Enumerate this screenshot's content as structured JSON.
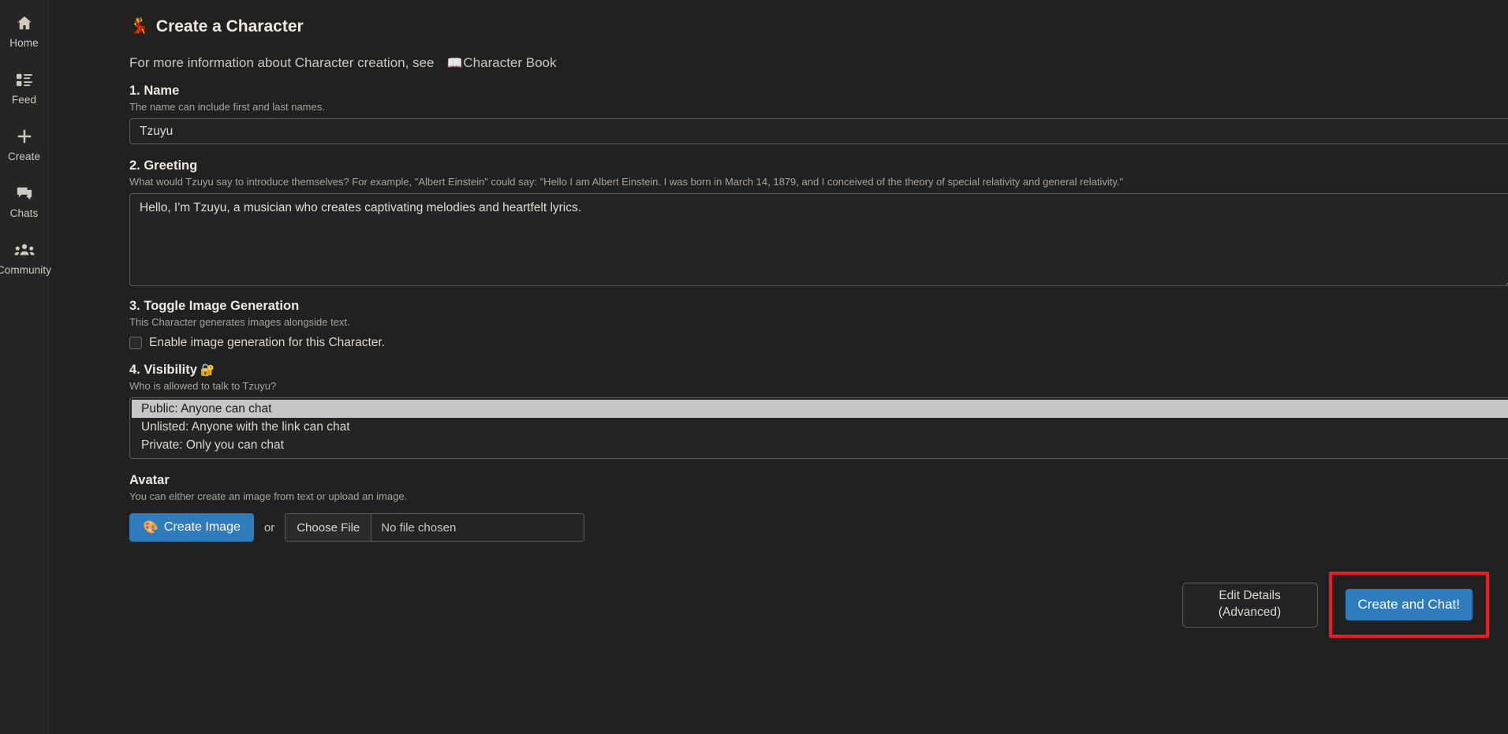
{
  "sidebar": {
    "items": [
      {
        "label": "Home",
        "icon": "home-icon"
      },
      {
        "label": "Feed",
        "icon": "feed-icon"
      },
      {
        "label": "Create",
        "icon": "plus-icon"
      },
      {
        "label": "Chats",
        "icon": "chat-bubbles-icon"
      },
      {
        "label": "Community",
        "icon": "people-icon"
      }
    ]
  },
  "header": {
    "title": "Create a Character",
    "title_icon": "💃",
    "info_prefix": "For more information about Character creation, see",
    "book_icon": "📖",
    "info_link": "Character Book"
  },
  "sections": {
    "name": {
      "title": "1. Name",
      "help": "The name can include first and last names.",
      "value": "Tzuyu",
      "placeholder": ""
    },
    "greeting": {
      "title": "2. Greeting",
      "help": "What would Tzuyu say to introduce themselves? For example, \"Albert Einstein\" could say: \"Hello I am Albert Einstein. I was born in March 14, 1879, and I conceived of the theory of special relativity and general relativity.\"",
      "value": "Hello, I'm Tzuyu, a musician who creates captivating melodies and heartfelt lyrics.",
      "placeholder": ""
    },
    "image_generation": {
      "title": "3. Toggle Image Generation",
      "help": "This Character generates images alongside text.",
      "checkbox_label": "Enable image generation for this Character.",
      "checked": false
    },
    "visibility": {
      "title": "4. Visibility",
      "lock_icon": "🔐",
      "help": "Who is allowed to talk to Tzuyu?",
      "options": [
        "Public: Anyone can chat",
        "Unlisted: Anyone with the link can chat",
        "Private: Only you can chat"
      ],
      "selected": "Public: Anyone can chat"
    },
    "avatar": {
      "title": "Avatar",
      "help": "You can either create an image from text or upload an image.",
      "create_image_label": "Create Image",
      "palette_icon": "🎨",
      "or_label": "or",
      "choose_file_label": "Choose File",
      "no_file_label": "No file chosen"
    }
  },
  "footer": {
    "edit_details_line1": "Edit Details",
    "edit_details_line2": "(Advanced)",
    "create_chat_label": "Create and Chat!"
  },
  "colors": {
    "accent_blue": "#2e7cbd",
    "highlight_red": "#ef1c24",
    "background": "#212121",
    "sidebar_bg": "#252525"
  }
}
